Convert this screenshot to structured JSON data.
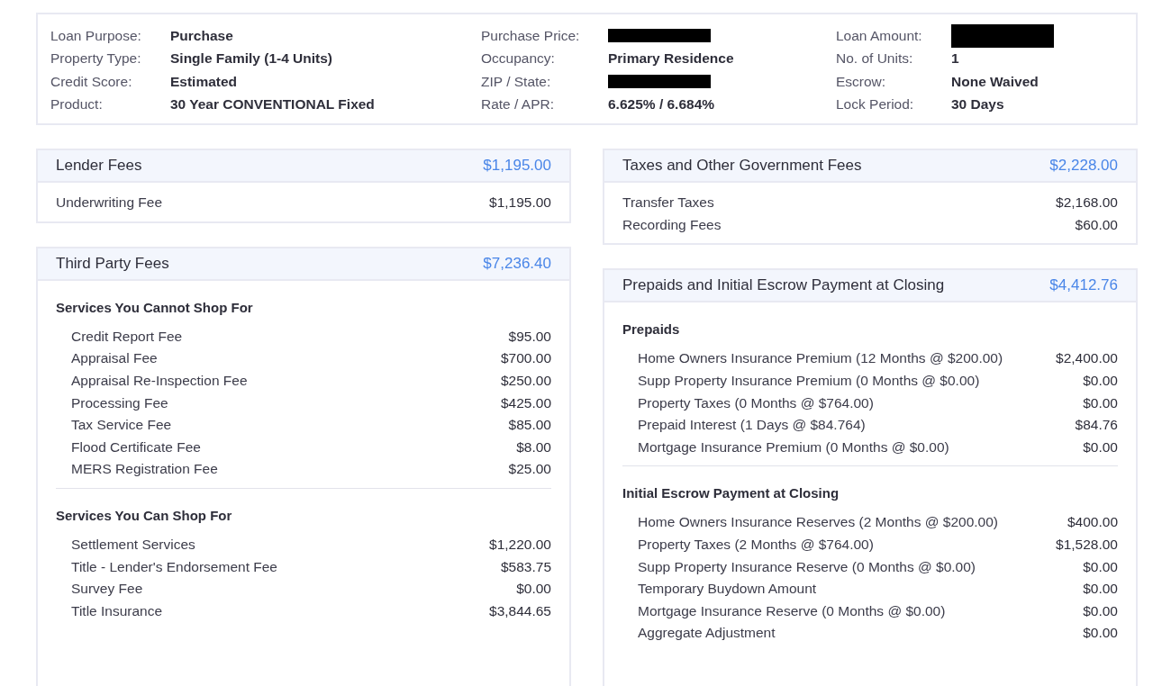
{
  "summary": [
    [
      {
        "label": "Loan Purpose:",
        "value": "Purchase"
      },
      {
        "label": "Purchase Price:",
        "redacted": true
      },
      {
        "label": "Loan Amount:",
        "redacted": true
      }
    ],
    [
      {
        "label": "Property Type:",
        "value": "Single Family (1-4 Units)"
      },
      {
        "label": "Occupancy:",
        "value": "Primary Residence"
      },
      {
        "label": "No. of Units:",
        "value": "1"
      }
    ],
    [
      {
        "label": "Credit Score:",
        "value": "Estimated"
      },
      {
        "label": "ZIP / State:",
        "redacted": true
      },
      {
        "label": "Escrow:",
        "value": "None Waived"
      }
    ],
    [
      {
        "label": "Product:",
        "value": "30 Year CONVENTIONAL Fixed"
      },
      {
        "label": "Rate / APR:",
        "value": "6.625% / 6.684%"
      },
      {
        "label": "Lock Period:",
        "value": "30 Days"
      }
    ]
  ],
  "columns": [
    [
      {
        "title": "Lender Fees",
        "total": "$1,195.00",
        "sections": [
          {
            "items": [
              {
                "label": "Underwriting Fee",
                "amount": "$1,195.00"
              }
            ]
          }
        ]
      },
      {
        "title": "Third Party Fees",
        "total": "$7,236.40",
        "sections": [
          {
            "heading": "Services You Cannot Shop For",
            "items": [
              {
                "label": "Credit Report Fee",
                "amount": "$95.00"
              },
              {
                "label": "Appraisal Fee",
                "amount": "$700.00"
              },
              {
                "label": "Appraisal Re-Inspection Fee",
                "amount": "$250.00"
              },
              {
                "label": "Processing Fee",
                "amount": "$425.00"
              },
              {
                "label": "Tax Service Fee",
                "amount": "$85.00"
              },
              {
                "label": "Flood Certificate Fee",
                "amount": "$8.00"
              },
              {
                "label": "MERS Registration Fee",
                "amount": "$25.00"
              }
            ]
          },
          {
            "heading": "Services You Can Shop For",
            "items": [
              {
                "label": "Settlement Services",
                "amount": "$1,220.00"
              },
              {
                "label": "Title - Lender's Endorsement Fee",
                "amount": "$583.75"
              },
              {
                "label": "Survey Fee",
                "amount": "$0.00"
              },
              {
                "label": "Title Insurance",
                "amount": "$3,844.65"
              }
            ]
          }
        ]
      }
    ],
    [
      {
        "title": "Taxes and Other Government Fees",
        "total": "$2,228.00",
        "sections": [
          {
            "items": [
              {
                "label": "Transfer Taxes",
                "amount": "$2,168.00"
              },
              {
                "label": "Recording Fees",
                "amount": "$60.00"
              }
            ]
          }
        ]
      },
      {
        "title": "Prepaids and Initial Escrow Payment at Closing",
        "total": "$4,412.76",
        "sections": [
          {
            "heading": "Prepaids",
            "items": [
              {
                "label": "Home Owners Insurance Premium (12 Months @ $200.00)",
                "amount": "$2,400.00"
              },
              {
                "label": "Supp Property Insurance Premium (0 Months @ $0.00)",
                "amount": "$0.00"
              },
              {
                "label": "Property Taxes (0 Months @ $764.00)",
                "amount": "$0.00"
              },
              {
                "label": "Prepaid Interest (1 Days @ $84.764)",
                "amount": "$84.76"
              },
              {
                "label": "Mortgage Insurance Premium (0 Months @ $0.00)",
                "amount": "$0.00"
              }
            ]
          },
          {
            "heading": "Initial Escrow Payment at Closing",
            "items": [
              {
                "label": "Home Owners Insurance Reserves (2 Months @ $200.00)",
                "amount": "$400.00"
              },
              {
                "label": "Property Taxes (2 Months @ $764.00)",
                "amount": "$1,528.00"
              },
              {
                "label": "Supp Property Insurance Reserve (0 Months @ $0.00)",
                "amount": "$0.00"
              },
              {
                "label": "Temporary Buydown Amount",
                "amount": "$0.00"
              },
              {
                "label": "Mortgage Insurance Reserve (0 Months @ $0.00)",
                "amount": "$0.00"
              },
              {
                "label": "Aggregate Adjustment",
                "amount": "$0.00"
              }
            ]
          }
        ]
      }
    ]
  ]
}
